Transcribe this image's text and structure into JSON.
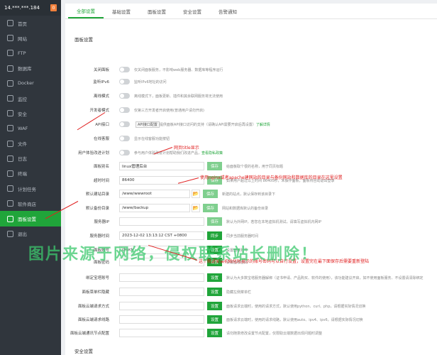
{
  "server": {
    "ip": "14.***.***.184",
    "badge": "0"
  },
  "sidebar": {
    "items": [
      {
        "label": "首页",
        "icon": "home-icon"
      },
      {
        "label": "网站",
        "icon": "globe-icon"
      },
      {
        "label": "FTP",
        "icon": "ftp-icon"
      },
      {
        "label": "数据库",
        "icon": "database-icon"
      },
      {
        "label": "Docker",
        "icon": "docker-icon"
      },
      {
        "label": "监控",
        "icon": "monitor-icon"
      },
      {
        "label": "安全",
        "icon": "shield-icon"
      },
      {
        "label": "WAF",
        "icon": "waf-icon"
      },
      {
        "label": "文件",
        "icon": "folder-icon"
      },
      {
        "label": "日志",
        "icon": "log-icon"
      },
      {
        "label": "终端",
        "icon": "terminal-icon"
      },
      {
        "label": "计划任务",
        "icon": "clock-icon"
      },
      {
        "label": "软件商店",
        "icon": "store-icon"
      },
      {
        "label": "面板设置",
        "icon": "gear-icon"
      },
      {
        "label": "退出",
        "icon": "exit-icon"
      }
    ]
  },
  "tabs": [
    "全部设置",
    "基础设置",
    "面板设置",
    "安全设置",
    "告警通知"
  ],
  "section_title": "面板设置",
  "rows": {
    "close_panel": {
      "label": "关闭面板",
      "desc": "仅关闭面板服务，不影响web服务器、数据库等程序运行"
    },
    "ipv6": {
      "label": "监听IPv6",
      "desc": "监听IPv6地址的访问"
    },
    "offline": {
      "label": "离线模式",
      "desc": "离线模式下，面板更新、插件和其余联网服务将无法使用"
    },
    "dev": {
      "label": "开发者模式",
      "desc": "仅第三方开发者开启使用(普通用户请勿开启)"
    },
    "api": {
      "label": "API接口",
      "chip": "API接口配置",
      "desc": "提供面板API接口访问的支持（请确认API需要开启后再设置）",
      "link": "了解详情"
    },
    "debug": {
      "label": "在线客服",
      "desc": "显示在线客服功能按钮"
    },
    "ux": {
      "label": "用户体验改进计划",
      "desc": "参与用户体验改进计划帮助我们改进产品，",
      "link": "查看隐私政策"
    },
    "alias": {
      "label": "面板别名",
      "value": "linux管理后台",
      "btn": "保存",
      "desc": "给面板取个很的名称，用于同页标题"
    },
    "timeout": {
      "label": "超时时间",
      "value": "86400",
      "btn": "保存",
      "desc": "如果用户超过以上时间 86400秒，未操作面板，面板将自动退出登录"
    },
    "site_dir": {
      "label": "默认建站目录",
      "value": "/www/wwwroot",
      "btn": "保存",
      "desc": "新建的站点，默认保存到该目录下"
    },
    "backup_dir": {
      "label": "默认备份目录",
      "value": "/www/backup",
      "btn": "保存",
      "desc": "网站和数据库默认的备份目录"
    },
    "server_ip": {
      "label": "服务器IP",
      "value": "",
      "btn": "保存",
      "desc": "默认为外网IP，若您在本地虚拟机测试，请填写虚拟机内网IP"
    },
    "server_time": {
      "label": "服务器时间",
      "value": "2023-12-02 13:13:12 CST +0800",
      "btn": "同步",
      "desc": "同步当前服务器时间"
    },
    "account": {
      "label": "面板账号",
      "value": "chuck",
      "btn": "设置",
      "desc": "设置面板账号"
    },
    "password": {
      "label": "面板密码",
      "value": "",
      "btn": "设置",
      "desc": "设置面板密码"
    },
    "bind_account": {
      "label": "绑定宝塔账号",
      "value": "",
      "btn": "设置",
      "desc": "默认为大多数宝塔服务器解绑（证书申请、产品购买、软件的使用），该功能建议开启，如不使用面板服务、不设置请清除绑定"
    },
    "menu": {
      "label": "面板菜单栏隐藏",
      "value": "",
      "btn": "设置",
      "desc": "隐藏左侧菜单栏"
    },
    "cloud_method": {
      "label": "面板云端请求方式",
      "value": "",
      "btn": "设置",
      "desc": "面板请求云端时，使用的请求方式，默认使用python、curl、php，请根据实际情况切换"
    },
    "cloud_line": {
      "label": "面板云端请求线路",
      "value": "",
      "btn": "设置",
      "desc": "面板请求云端时，使用的请求线路，默认使用auto、ipv4、ipv6，请根据实际情况切换"
    },
    "cloud_node": {
      "label": "面板云端通讯节点配置",
      "value": "",
      "btn": "设置",
      "desc": "请勿随意修改设置节点配置，仅限取云端数据出现问题时调整"
    }
  },
  "annotations": {
    "title_note": "网页title显示",
    "dir_note": "使用nginx或者apache建网站的目录与备份网站和数据库的目录在这里设置",
    "account_note": "这个就是安装初始化时提示的账号密码可以自行设置，设置完在最下面保存后需要重新登陆",
    "watermark": "图片来源于网络，侵权联系站长删除！"
  },
  "security_title": "安全设置"
}
